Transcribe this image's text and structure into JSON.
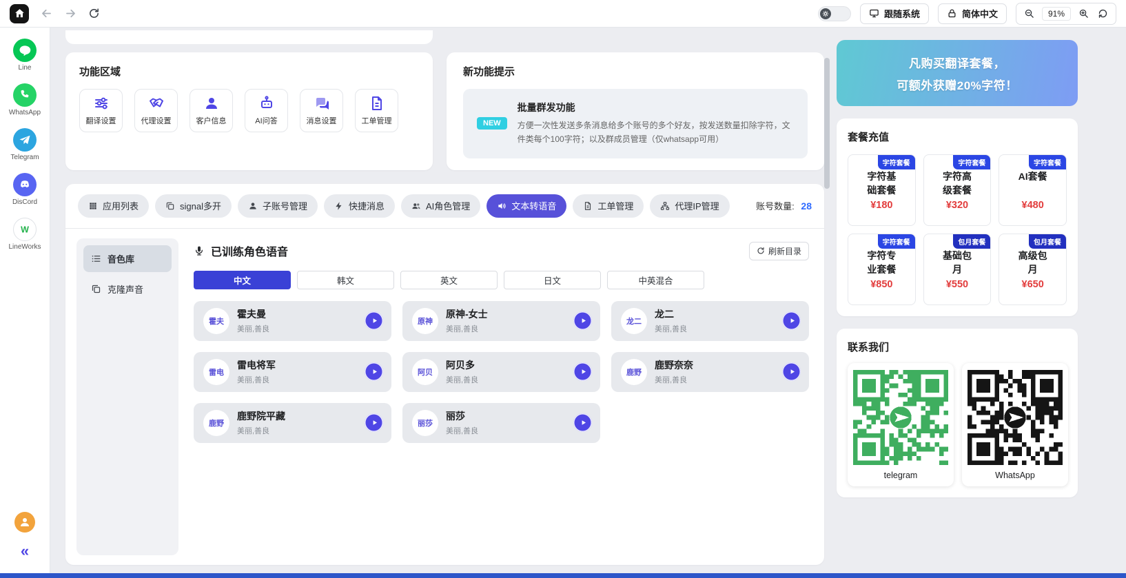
{
  "topbar": {
    "follow_system_label": "跟随系统",
    "language_label": "简体中文",
    "zoom_level": "91%"
  },
  "app_sidebar": {
    "collapse_glyph": "«",
    "items": [
      {
        "label": "Line",
        "icon": "line-icon",
        "bg": "#06c755",
        "fg": "#ffffff"
      },
      {
        "label": "WhatsApp",
        "icon": "whatsapp-icon",
        "bg": "#25d366",
        "fg": "#ffffff"
      },
      {
        "label": "Telegram",
        "icon": "telegram-icon",
        "bg": "#2ca5e0",
        "fg": "#ffffff"
      },
      {
        "label": "DisCord",
        "icon": "discord-icon",
        "bg": "#5865f2",
        "fg": "#ffffff"
      },
      {
        "label": "LineWorks",
        "icon": "lineworks-icon",
        "bg": "#ffffff",
        "fg": "#23b24b",
        "border": "#dfe2e6"
      }
    ]
  },
  "function_area": {
    "title": "功能区域",
    "buttons": [
      {
        "label": "翻译设置",
        "icon": "sliders-icon"
      },
      {
        "label": "代理设置",
        "icon": "handshake-icon"
      },
      {
        "label": "客户信息",
        "icon": "user-icon"
      },
      {
        "label": "AI问答",
        "icon": "robot-icon"
      },
      {
        "label": "消息设置",
        "icon": "chat-icon"
      },
      {
        "label": "工单管理",
        "icon": "document-icon"
      }
    ]
  },
  "new_feature": {
    "title": "新功能提示",
    "badge": "NEW",
    "feature_title": "批量群发功能",
    "description": "方便一次性发送多条消息给多个账号的多个好友，按发送数量扣除字符，文件类每个100字符；以及群成员管理（仅whatsapp可用）"
  },
  "main_tabs": {
    "account_count_label": "账号数量:",
    "account_count": "28",
    "items": [
      {
        "label": "应用列表",
        "icon": "grid-icon",
        "active": false
      },
      {
        "label": "signal多开",
        "icon": "copy-icon",
        "active": false
      },
      {
        "label": "子账号管理",
        "icon": "user-icon",
        "active": false
      },
      {
        "label": "快捷消息",
        "icon": "bolt-icon",
        "active": false
      },
      {
        "label": "AI角色管理",
        "icon": "users-icon",
        "active": false
      },
      {
        "label": "文本转语音",
        "icon": "speaker-icon",
        "active": true
      },
      {
        "label": "工单管理",
        "icon": "document-icon",
        "active": false
      },
      {
        "label": "代理IP管理",
        "icon": "network-icon",
        "active": false
      }
    ]
  },
  "voice_panel": {
    "title": "已训练角色语音",
    "refresh_label": "刷新目录",
    "nav": [
      {
        "label": "音色库",
        "icon": "list-icon",
        "active": true
      },
      {
        "label": "克隆声音",
        "icon": "clone-icon",
        "active": false
      }
    ],
    "language_tabs": [
      {
        "label": "中文",
        "active": true
      },
      {
        "label": "韩文",
        "active": false
      },
      {
        "label": "英文",
        "active": false
      },
      {
        "label": "日文",
        "active": false
      },
      {
        "label": "中英混合",
        "active": false
      }
    ],
    "voices": [
      {
        "avatar": "霍夫",
        "name": "霍夫曼",
        "desc": "美丽,善良"
      },
      {
        "avatar": "原神",
        "name": "原神-女士",
        "desc": "美丽,善良"
      },
      {
        "avatar": "龙二",
        "name": "龙二",
        "desc": "美丽,善良"
      },
      {
        "avatar": "雷电",
        "name": "雷电将军",
        "desc": "美丽,善良"
      },
      {
        "avatar": "阿贝",
        "name": "阿贝多",
        "desc": "美丽,善良"
      },
      {
        "avatar": "鹿野",
        "name": "鹿野奈奈",
        "desc": "美丽,善良"
      },
      {
        "avatar": "鹿野",
        "name": "鹿野院平藏",
        "desc": "美丽,善良"
      },
      {
        "avatar": "丽莎",
        "name": "丽莎",
        "desc": "美丽,善良"
      }
    ]
  },
  "promo": {
    "line1": "凡购买翻译套餐，",
    "line2": "可额外获赠20%字符！"
  },
  "recharge": {
    "title": "套餐充值",
    "packages": [
      {
        "badge": "字符套餐",
        "badge_type": "char",
        "name": "字符基础套餐",
        "price": "¥180"
      },
      {
        "badge": "字符套餐",
        "badge_type": "char",
        "name": "字符高级套餐",
        "price": "¥320"
      },
      {
        "badge": "字符套餐",
        "badge_type": "char",
        "name": "AI套餐",
        "price": "¥480"
      },
      {
        "badge": "字符套餐",
        "badge_type": "char",
        "name": "字符专业套餐",
        "price": "¥850"
      },
      {
        "badge": "包月套餐",
        "badge_type": "monthly",
        "name": "基础包月",
        "price": "¥550"
      },
      {
        "badge": "包月套餐",
        "badge_type": "monthly",
        "name": "高级包月",
        "price": "¥650"
      }
    ]
  },
  "contact": {
    "title": "联系我们",
    "qr_codes": [
      {
        "label": "telegram",
        "color": "#3fae5f"
      },
      {
        "label": "WhatsApp",
        "color": "#151515"
      }
    ]
  },
  "colors": {
    "primary": "#4f46e5",
    "active_tab": "#5751d9",
    "active_lang_tab": "#3a41d6",
    "price_red": "#e23c3c",
    "count_blue": "#2f6bff",
    "new_badge": "#30cfe2",
    "promo_gradient_start": "#5fc9d3",
    "promo_gradient_end": "#7e9cf4"
  }
}
